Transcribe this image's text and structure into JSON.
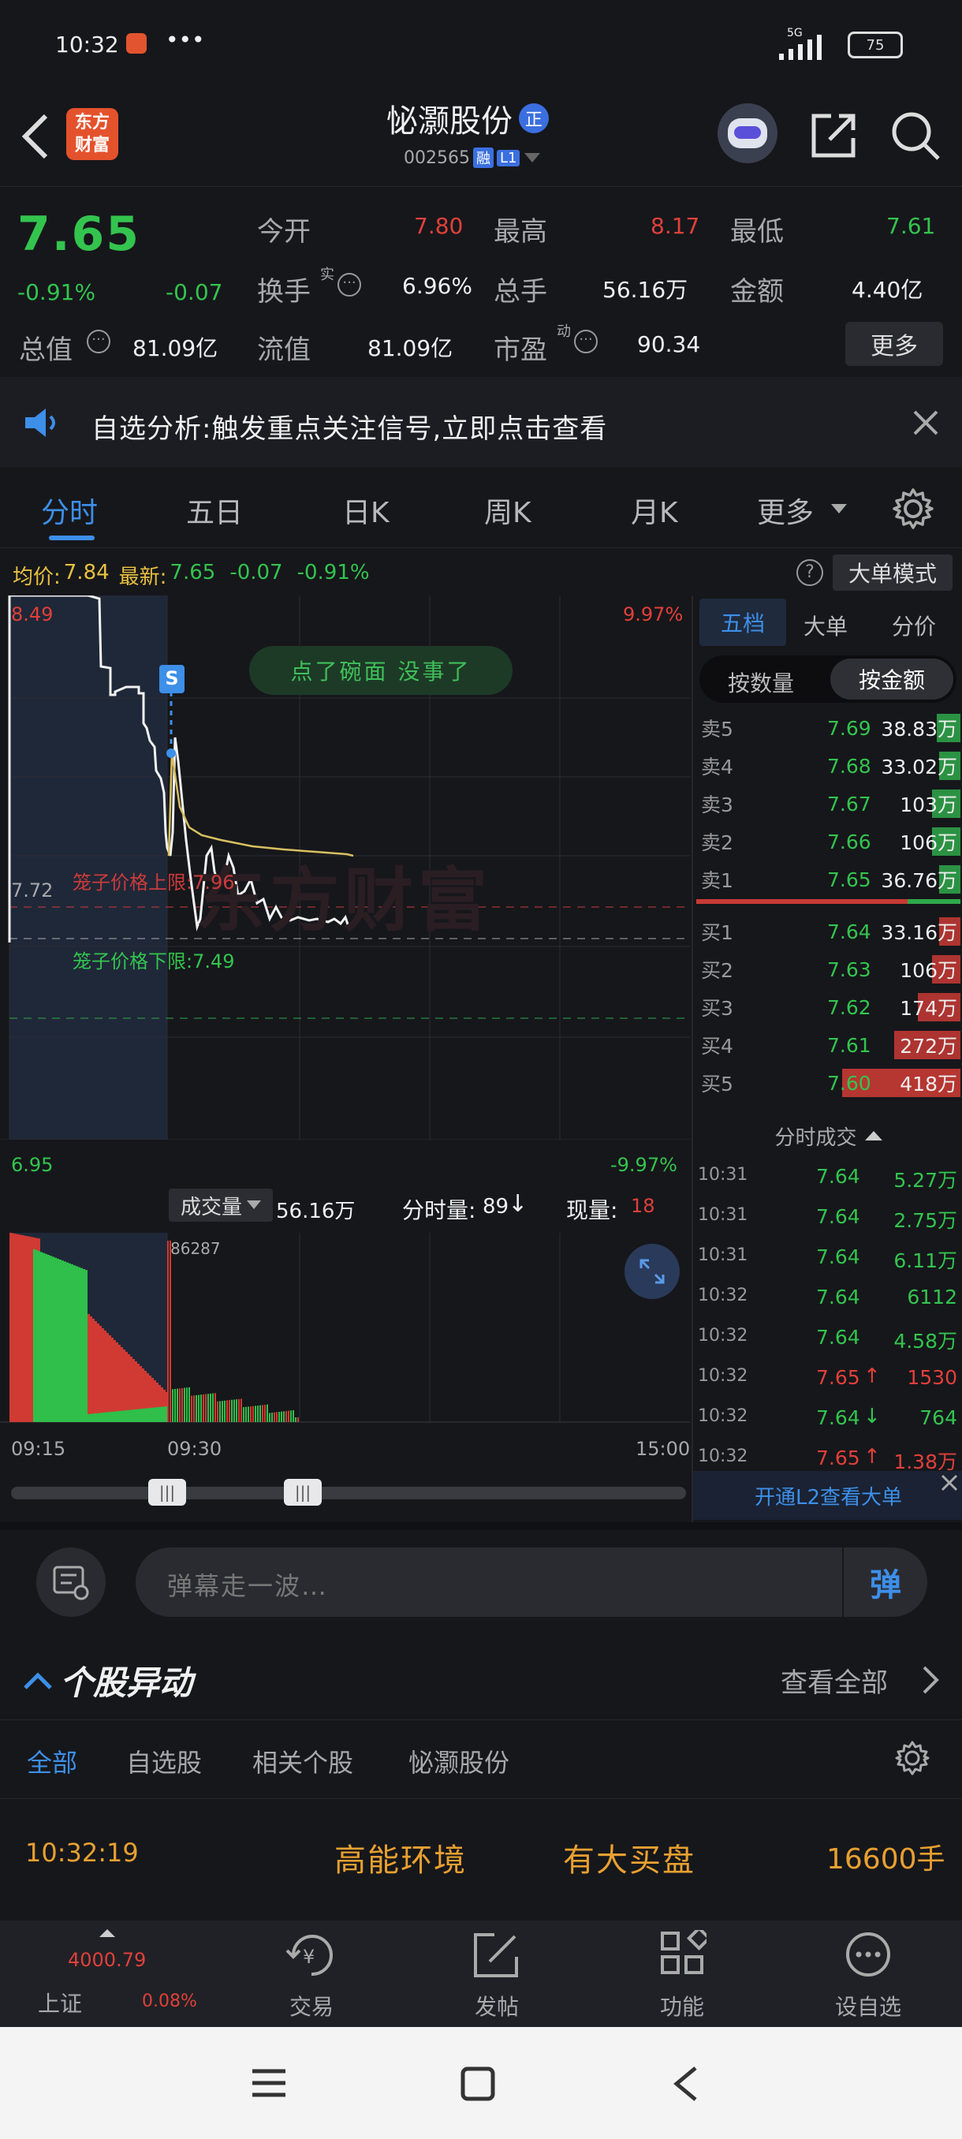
{
  "status": {
    "time": "10:32",
    "dots": "•••",
    "network": "5G",
    "battery": "75"
  },
  "header": {
    "logo_line1": "东方",
    "logo_line2": "财富",
    "stock_name": "怭灏股份",
    "zheng_badge": "正",
    "stock_code": "002565",
    "badge_rong": "融",
    "badge_l1": "L1"
  },
  "quote": {
    "price": "7.65",
    "change_pct": "-0.91%",
    "change": "-0.07",
    "open_label": "今开",
    "open": "7.80",
    "high_label": "最高",
    "high": "8.17",
    "low_label": "最低",
    "low": "7.61",
    "turnover_label": "换手",
    "turnover_sup": "实",
    "turnover": "6.96%",
    "volume_label": "总手",
    "volume": "56.16万",
    "amount_label": "金额",
    "amount": "4.40亿",
    "total_cap_label": "总值",
    "total_cap": "81.09亿",
    "float_cap_label": "流值",
    "float_cap": "81.09亿",
    "pe_label": "市盈",
    "pe_sup": "动",
    "pe": "90.34",
    "more_label": "更多"
  },
  "notice": {
    "text": "自选分析:触发重点关注信号,立即点击查看"
  },
  "tabs": [
    "分时",
    "五日",
    "日K",
    "周K",
    "月K",
    "更多"
  ],
  "chart_info": {
    "avg_label": "均价:",
    "avg": "7.84",
    "latest_label": "最新:",
    "latest": "7.65",
    "chg": "-0.07",
    "pct": "-0.91%",
    "mode_button": "大单模式"
  },
  "chart": {
    "top_price": "8.49",
    "top_pct": "9.97%",
    "mid_price": "7.72",
    "bottom_price": "6.95",
    "bottom_pct": "-9.97%",
    "bubble": "点了碗面 没事了",
    "s_marker": "S",
    "upper_limit_label": "笼子价格上限:7.96",
    "lower_limit_label": "笼子价格下限:7.49",
    "watermark": "东方财富"
  },
  "volume_bar": {
    "selector": "成交量",
    "total": "56.16万",
    "minute_label": "分时量:",
    "minute": "89",
    "current_label": "现量:",
    "current": "18",
    "peak": "86287"
  },
  "time_axis": [
    "09:15",
    "09:30",
    "15:00"
  ],
  "orderbook": {
    "tabs": [
      "五档",
      "大单",
      "分价"
    ],
    "modes": [
      "按数量",
      "按金额"
    ],
    "sells": [
      {
        "label": "卖5",
        "price": "7.69",
        "amount": "38.83万",
        "frac": 0.1
      },
      {
        "label": "卖4",
        "price": "7.68",
        "amount": "33.02万",
        "frac": 0.09
      },
      {
        "label": "卖3",
        "price": "7.67",
        "amount": "103万",
        "frac": 0.12
      },
      {
        "label": "卖2",
        "price": "7.66",
        "amount": "106万",
        "frac": 0.12
      },
      {
        "label": "卖1",
        "price": "7.65",
        "amount": "36.76万",
        "frac": 0.09
      }
    ],
    "buys": [
      {
        "label": "买1",
        "price": "7.64",
        "amount": "33.16万",
        "frac": 0.09
      },
      {
        "label": "买2",
        "price": "7.63",
        "amount": "106万",
        "frac": 0.12
      },
      {
        "label": "买3",
        "price": "7.62",
        "amount": "174万",
        "frac": 0.18
      },
      {
        "label": "买4",
        "price": "7.61",
        "amount": "272万",
        "frac": 0.28
      },
      {
        "label": "买5",
        "price": "7.60",
        "amount": "418万",
        "frac": 0.5
      }
    ],
    "ticks_title": "分时成交",
    "ticks": [
      {
        "time": "10:31",
        "price": "7.64",
        "vol": "5.27万",
        "dir": ""
      },
      {
        "time": "10:31",
        "price": "7.64",
        "vol": "2.75万",
        "dir": ""
      },
      {
        "time": "10:31",
        "price": "7.64",
        "vol": "6.11万",
        "dir": ""
      },
      {
        "time": "10:32",
        "price": "7.64",
        "vol": "6112",
        "dir": ""
      },
      {
        "time": "10:32",
        "price": "7.64",
        "vol": "4.58万",
        "dir": ""
      },
      {
        "time": "10:32",
        "price": "7.65",
        "vol": "1530",
        "dir": "↑"
      },
      {
        "time": "10:32",
        "price": "7.64",
        "vol": "764",
        "dir": "↓"
      },
      {
        "time": "10:32",
        "price": "7.65",
        "vol": "1.38万",
        "dir": "↑"
      }
    ],
    "l2_link": "开通L2查看大单"
  },
  "danmu": {
    "placeholder": "弹幕走一波…",
    "send_icon_text": "弹"
  },
  "anomaly": {
    "title": "个股异动",
    "view_all": "查看全部",
    "filters": [
      "全部",
      "自选股",
      "相关个股",
      "怭灏股份"
    ],
    "item": {
      "time": "10:32:19",
      "sector": "高能环境",
      "event": "有大买盘",
      "volume": "16600手"
    }
  },
  "bottom": {
    "index_value": "4000.79",
    "index_name": "上证",
    "index_pct": "0.08%",
    "items": [
      "交易",
      "发帖",
      "功能",
      "设自选"
    ]
  },
  "colors": {
    "up": "#e0403a",
    "down": "#33c44e",
    "accent": "#3d8fe8",
    "bg": "#16171b"
  }
}
